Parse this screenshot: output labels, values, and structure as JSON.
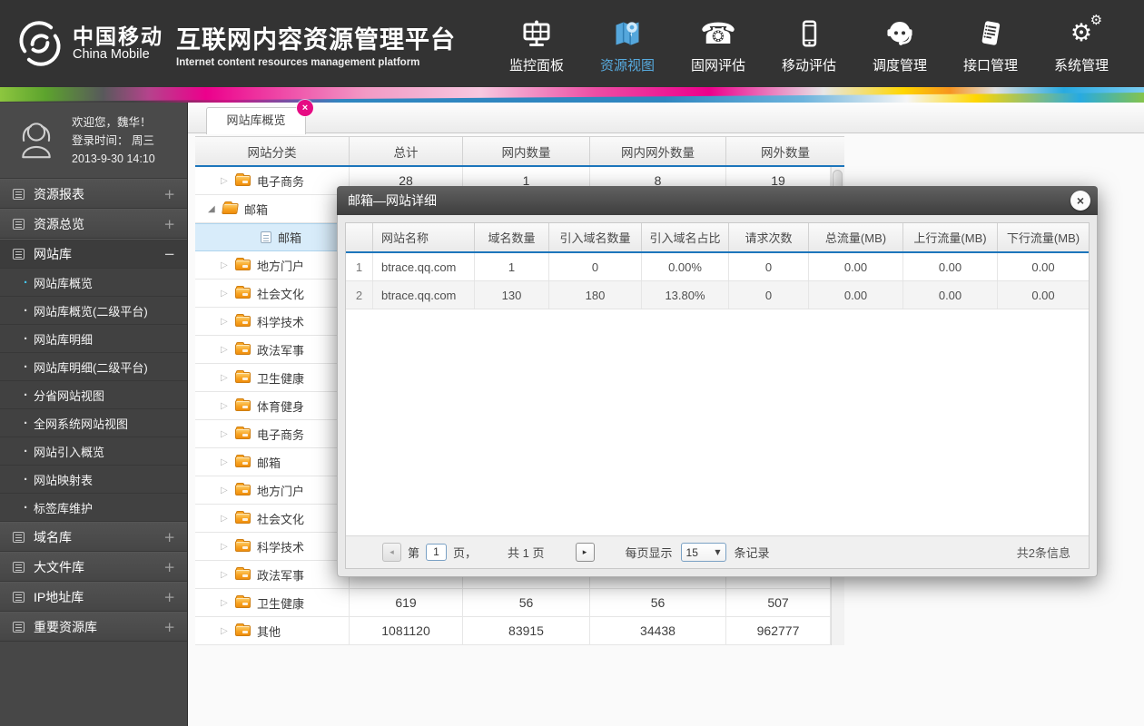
{
  "header": {
    "brand_cn": "中国移动",
    "brand_en": "China Mobile",
    "title_cn": "互联网内容资源管理平台",
    "title_en": "Internet content resources management platform",
    "nav": [
      {
        "label": "监控面板",
        "icon": "dashboard-icon",
        "active": false
      },
      {
        "label": "资源视图",
        "icon": "map-icon",
        "active": true
      },
      {
        "label": "固网评估",
        "icon": "phone-icon",
        "active": false
      },
      {
        "label": "移动评估",
        "icon": "mobile-icon",
        "active": false
      },
      {
        "label": "调度管理",
        "icon": "headset-icon",
        "active": false
      },
      {
        "label": "接口管理",
        "icon": "document-icon",
        "active": false
      },
      {
        "label": "系统管理",
        "icon": "gears-icon",
        "active": false
      }
    ]
  },
  "sidebar": {
    "welcome1": "欢迎您，魏华！",
    "welcome2": "登录时间：  周三",
    "welcome3": "2013-9-30   14:10",
    "groups": [
      {
        "label": "资源报表",
        "state": "+"
      },
      {
        "label": "资源总览",
        "state": "+"
      },
      {
        "label": "网站库",
        "state": "−",
        "expanded": true,
        "children": [
          "网站库概览",
          "网站库概览(二级平台)",
          "网站库明细",
          "网站库明细(二级平台)",
          "分省网站视图",
          "全网系统网站视图",
          "网站引入概览",
          "网站映射表",
          "标签库维护"
        ],
        "active_child": 0
      },
      {
        "label": "域名库",
        "state": "+"
      },
      {
        "label": "大文件库",
        "state": "+"
      },
      {
        "label": "IP地址库",
        "state": "+"
      },
      {
        "label": "重要资源库",
        "state": "+"
      }
    ]
  },
  "main": {
    "tab_label": "网站库概览",
    "table": {
      "headers": [
        "网站分类",
        "总计",
        "网内数量",
        "网内网外数量",
        "网外数量"
      ],
      "rows": [
        {
          "arrow": "collapsed",
          "icon": "folder",
          "level": 2,
          "label": "电子商务",
          "values": [
            "28",
            "1",
            "8",
            "19"
          ]
        },
        {
          "arrow": "expanded",
          "icon": "folder-open",
          "level": 1,
          "label": "邮箱",
          "values": [
            "",
            "",
            "",
            ""
          ]
        },
        {
          "arrow": "none",
          "icon": "doc",
          "level": 3,
          "label": "邮箱",
          "selected": true,
          "values": [
            "",
            "",
            "",
            ""
          ]
        },
        {
          "arrow": "collapsed",
          "icon": "folder",
          "level": 2,
          "label": "地方门户",
          "values": [
            "",
            "",
            "",
            ""
          ]
        },
        {
          "arrow": "collapsed",
          "icon": "folder",
          "level": 2,
          "label": "社会文化",
          "values": [
            "",
            "",
            "",
            ""
          ]
        },
        {
          "arrow": "collapsed",
          "icon": "folder",
          "level": 2,
          "label": "科学技术",
          "values": [
            "",
            "",
            "",
            ""
          ]
        },
        {
          "arrow": "collapsed",
          "icon": "folder",
          "level": 2,
          "label": "政法军事",
          "values": [
            "",
            "",
            "",
            ""
          ]
        },
        {
          "arrow": "collapsed",
          "icon": "folder",
          "level": 2,
          "label": "卫生健康",
          "values": [
            "",
            "",
            "",
            ""
          ]
        },
        {
          "arrow": "collapsed",
          "icon": "folder",
          "level": 2,
          "label": "体育健身",
          "values": [
            "",
            "",
            "",
            ""
          ]
        },
        {
          "arrow": "collapsed",
          "icon": "folder",
          "level": 2,
          "label": "电子商务",
          "values": [
            "",
            "",
            "",
            ""
          ]
        },
        {
          "arrow": "collapsed",
          "icon": "folder",
          "level": 2,
          "label": "邮箱",
          "values": [
            "",
            "",
            "",
            ""
          ]
        },
        {
          "arrow": "collapsed",
          "icon": "folder",
          "level": 2,
          "label": "地方门户",
          "values": [
            "",
            "",
            "",
            ""
          ]
        },
        {
          "arrow": "collapsed",
          "icon": "folder",
          "level": 2,
          "label": "社会文化",
          "values": [
            "",
            "",
            "",
            ""
          ]
        },
        {
          "arrow": "collapsed",
          "icon": "folder",
          "level": 2,
          "label": "科学技术",
          "values": [
            "",
            "",
            "",
            ""
          ]
        },
        {
          "arrow": "collapsed",
          "icon": "folder",
          "level": 2,
          "label": "政法军事",
          "values": [
            "",
            "",
            "",
            ""
          ]
        },
        {
          "arrow": "collapsed",
          "icon": "folder",
          "level": 2,
          "label": "卫生健康",
          "values": [
            "619",
            "56",
            "56",
            "507"
          ]
        },
        {
          "arrow": "collapsed",
          "icon": "folder",
          "level": 2,
          "label": "其他",
          "values": [
            "1081120",
            "83915",
            "34438",
            "962777"
          ]
        }
      ]
    }
  },
  "modal": {
    "title": "邮箱—网站详细",
    "close_icon": "close-icon",
    "table": {
      "headers": [
        "",
        "网站名称",
        "域名数量",
        "引入域名数量",
        "引入域名占比",
        "请求次数",
        "总流量(MB)",
        "上行流量(MB)",
        "下行流量(MB)"
      ],
      "rows": [
        [
          "1",
          "btrace.qq.com",
          "1",
          "0",
          "0.00%",
          "0",
          "0.00",
          "0.00",
          "0.00"
        ],
        [
          "2",
          "btrace.qq.com",
          "130",
          "180",
          "13.80%",
          "0",
          "0.00",
          "0.00",
          "0.00"
        ]
      ]
    },
    "pagination": {
      "prefix": "第",
      "page": "1",
      "suffix": "页，",
      "total_pages": "共 1 页",
      "per_page_label": "每页显示",
      "per_page": "15",
      "records_label": "条记录",
      "total_info": "共2条信息"
    }
  },
  "colors": {
    "accent_blue": "#57aade",
    "header_underline": "#1d76bc",
    "tab_close_pink": "#e60b83",
    "folder_orange": "#f8a422",
    "ribbon_magenta": "#ec008c"
  }
}
